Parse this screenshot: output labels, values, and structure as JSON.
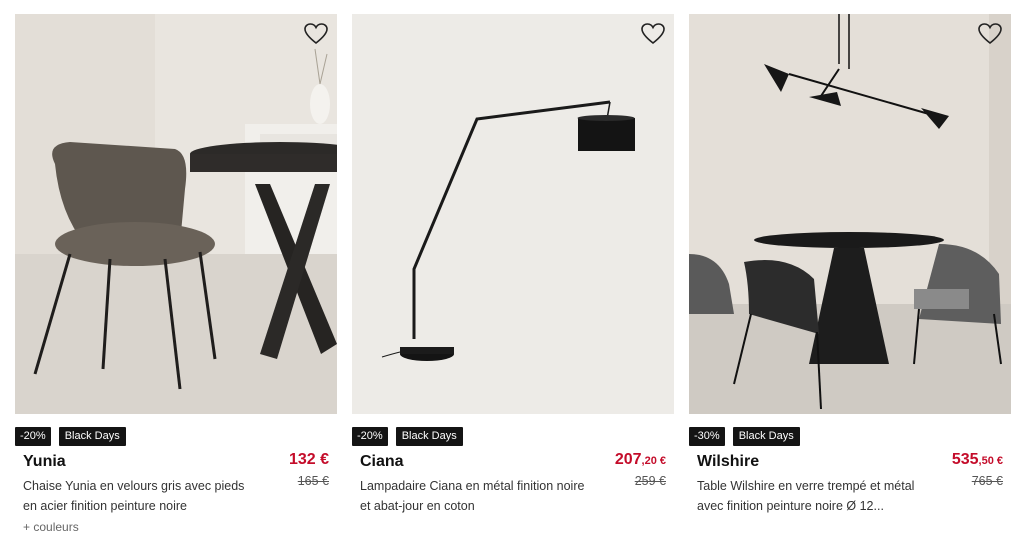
{
  "products": [
    {
      "discount": "-20%",
      "tag": "Black Days",
      "name": "Yunia",
      "description": "Chaise Yunia en velours gris avec pieds en acier finition peinture noire",
      "price_int": "132",
      "price_dec": "",
      "currency": " €",
      "old_price": "165 €",
      "extra": "+ couleurs",
      "image_icon": "chair-photo"
    },
    {
      "discount": "-20%",
      "tag": "Black Days",
      "name": "Ciana",
      "description": "Lampadaire Ciana en métal finition noire et abat-jour en coton",
      "price_int": "207",
      "price_dec": ",20 €",
      "currency": "",
      "old_price": "259 €",
      "image_icon": "floor-lamp-photo"
    },
    {
      "discount": "-30%",
      "tag": "Black Days",
      "name": "Wilshire",
      "description": "Table Wilshire en verre trempé et métal avec finition peinture noire Ø 12...",
      "price_int": "535",
      "price_dec": ",50 €",
      "currency": "",
      "old_price": "765 €",
      "image_icon": "table-photo"
    }
  ],
  "colors": {
    "price": "#c40c2a",
    "badge_bg": "#141414"
  }
}
